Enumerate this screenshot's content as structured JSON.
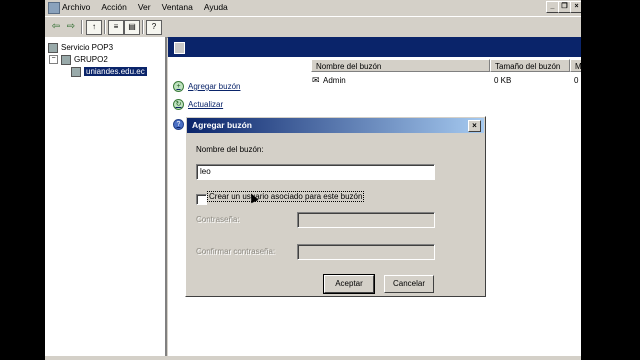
{
  "menu": {
    "items": [
      "Archivo",
      "Acción",
      "Ver",
      "Ventana",
      "Ayuda"
    ]
  },
  "window_controls": {
    "minimize": "_",
    "restore": "❐",
    "close": "×"
  },
  "toolbar": {
    "icons": [
      "back-arrow-icon",
      "forward-arrow-icon",
      "up-folder-icon",
      "properties-icon",
      "export-list-icon",
      "help-icon"
    ]
  },
  "tree": {
    "items": [
      {
        "label": "Servicio POP3",
        "level": 0
      },
      {
        "label": "GRUPO2",
        "level": 1
      },
      {
        "label": "uniandes.edu.ec",
        "level": 2,
        "selected": true
      }
    ]
  },
  "tasks": {
    "items": [
      {
        "label": "Agregar buzón",
        "icon": "add-circle-icon"
      },
      {
        "label": "Actualizar",
        "icon": "refresh-icon"
      },
      {
        "label": "",
        "icon": "help-icon"
      }
    ]
  },
  "list": {
    "columns": [
      "Nombre del buzón",
      "Tamaño del buzón",
      "Me"
    ],
    "rows": [
      {
        "name": "Admin",
        "size": "0 KB",
        "messages": "0"
      }
    ]
  },
  "dialog": {
    "title": "Agregar buzón",
    "close": "×",
    "mailbox_label": "Nombre del buzón:",
    "mailbox_value": "leo",
    "checkbox_label": "Crear un usuario asociado para este buzón",
    "password_label": "Contraseña:",
    "confirm_label": "Confirmar contraseña:",
    "ok_label": "Aceptar",
    "cancel_label": "Cancelar"
  },
  "colors": {
    "title_bar": "#0a246a",
    "selection": "#0a246a",
    "face": "#d4d0c8"
  }
}
